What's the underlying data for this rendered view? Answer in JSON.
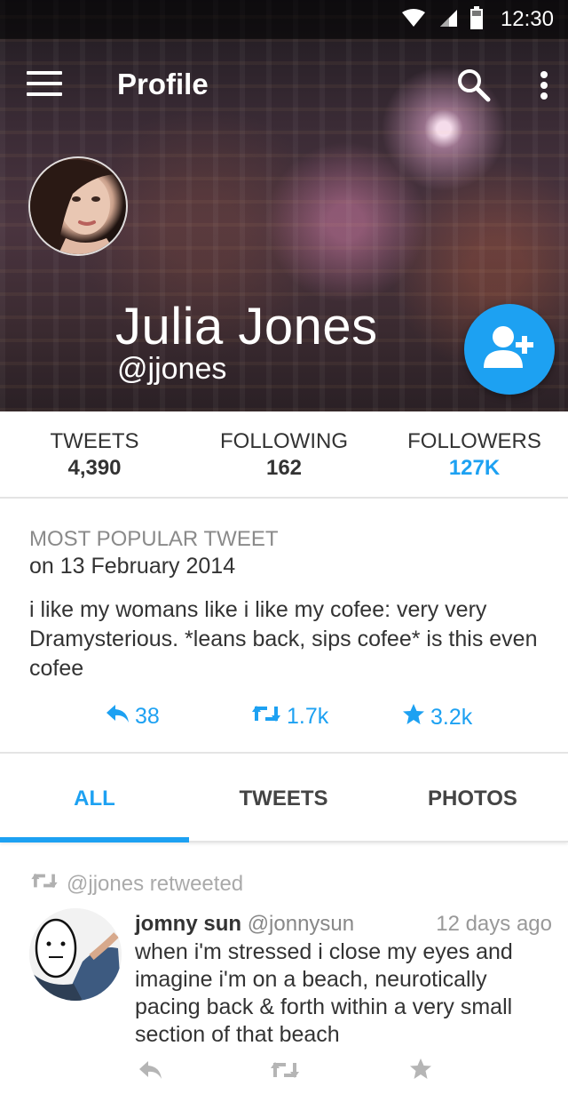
{
  "status_bar": {
    "time": "12:30",
    "icons": [
      "wifi-icon",
      "signal-icon",
      "battery-icon"
    ]
  },
  "toolbar": {
    "title": "Profile",
    "menu_icon": "menu-icon",
    "search_icon": "search-icon",
    "more_icon": "more-vert-icon"
  },
  "profile": {
    "name": "Julia Jones",
    "handle": "@jjones",
    "follow_icon": "add-person-icon"
  },
  "stats": [
    {
      "label": "TWEETS",
      "value": "4,390"
    },
    {
      "label": "FOLLOWING",
      "value": "162"
    },
    {
      "label": "FOLLOWERS",
      "value": "127K"
    }
  ],
  "popular_tweet": {
    "heading": "MOST POPULAR TWEET",
    "date": "on 13 February 2014",
    "text": "i like my womans like i like my cofee: very very Dramysterious. *leans back, sips cofee* is this even cofee",
    "replies": "38",
    "retweets": "1.7k",
    "favorites": "3.2k"
  },
  "tabs": [
    {
      "label": "ALL",
      "active": true
    },
    {
      "label": "TWEETS",
      "active": false
    },
    {
      "label": "PHOTOS",
      "active": false
    }
  ],
  "timeline": [
    {
      "retweeted_by": "@jjones retweeted",
      "author": "jomny sun",
      "handle": "@jonnysun",
      "time": "12 days ago",
      "text": "when i'm stressed i close my eyes and imagine i'm on a beach, neurotically pacing back & forth within a very small section of that beach"
    }
  ],
  "colors": {
    "accent": "#1da1f2",
    "divider": "#e4e4e4",
    "muted_text": "#8a8a8a"
  }
}
